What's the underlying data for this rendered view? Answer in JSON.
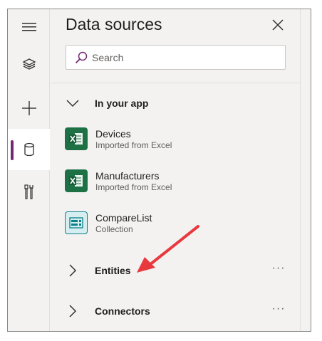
{
  "panel": {
    "title": "Data sources",
    "search_placeholder": "Search"
  },
  "rail": {
    "items": [
      {
        "icon": "hamburger-menu-icon"
      },
      {
        "icon": "layers-icon"
      },
      {
        "icon": "plus-icon"
      },
      {
        "icon": "database-icon",
        "active": true
      },
      {
        "icon": "tools-icon"
      }
    ],
    "active_color": "#742774"
  },
  "groups": {
    "in_your_app": {
      "label": "In your app",
      "items": [
        {
          "name": "Devices",
          "subtitle": "Imported from Excel",
          "icon": "excel-icon"
        },
        {
          "name": "Manufacturers",
          "subtitle": "Imported from Excel",
          "icon": "excel-icon"
        },
        {
          "name": "CompareList",
          "subtitle": "Collection",
          "icon": "collection-icon"
        }
      ]
    },
    "entities": {
      "label": "Entities",
      "more": "···"
    },
    "connectors": {
      "label": "Connectors",
      "more": "···"
    }
  },
  "annotation": {
    "arrow_color": "#e8393e"
  },
  "colors": {
    "excel": "#1e7145",
    "collection": "#0b7f8a",
    "accent": "#742774"
  }
}
